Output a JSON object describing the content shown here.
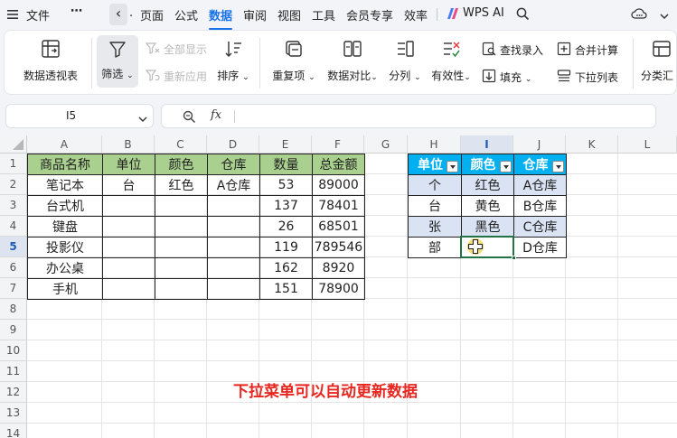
{
  "menu": {
    "file": "文件",
    "more": "⋯",
    "back_chevron": "‹",
    "dot": ".",
    "tabs": [
      "页面",
      "公式",
      "数据",
      "审阅",
      "视图",
      "工具",
      "会员专享",
      "效率"
    ],
    "active_tab": "数据",
    "wps_ai": "WPS AI"
  },
  "ribbon": {
    "pivot": "数据透视表",
    "filter": "筛选",
    "show_all": "全部显示",
    "reapply": "重新应用",
    "sort": "排序",
    "duplicates": "重复项",
    "compare": "数据对比",
    "split": "分列",
    "validity": "有效性",
    "lookup_entry": "查找录入",
    "fill": "填充",
    "merge_calc": "合并计算",
    "dropdown_list": "下拉列表",
    "classify_sum": "分类汇"
  },
  "formula_bar": {
    "name_box": "I5",
    "fx": "fx",
    "value": ""
  },
  "columns": [
    "A",
    "B",
    "C",
    "D",
    "E",
    "F",
    "G",
    "H",
    "I",
    "J",
    "K",
    "L"
  ],
  "selected_column": "I",
  "rows": [
    "1",
    "2",
    "3",
    "4",
    "5",
    "6",
    "7",
    "8",
    "9",
    "10",
    "11",
    "12",
    "13",
    "14"
  ],
  "selected_row": "5",
  "table1": {
    "headers": [
      "商品名称",
      "单位",
      "颜色",
      "仓库",
      "数量",
      "总金额"
    ],
    "rows": [
      [
        "笔记本",
        "台",
        "红色",
        "A仓库",
        "53",
        "89000"
      ],
      [
        "台式机",
        "",
        "",
        "",
        "137",
        "78401"
      ],
      [
        "键盘",
        "",
        "",
        "",
        "26",
        "68501"
      ],
      [
        "投影仪",
        "",
        "",
        "",
        "119",
        "789546"
      ],
      [
        "办公桌",
        "",
        "",
        "",
        "162",
        "8920"
      ],
      [
        "手机",
        "",
        "",
        "",
        "151",
        "78900"
      ]
    ]
  },
  "table2": {
    "headers": [
      "单位",
      "颜色",
      "仓库"
    ],
    "rows": [
      [
        "个",
        "红色",
        "A仓库"
      ],
      [
        "台",
        "黄色",
        "B仓库"
      ],
      [
        "张",
        "黑色",
        "C仓库"
      ],
      [
        "部",
        "",
        "D仓库"
      ]
    ]
  },
  "annotation": "下拉菜单可以自动更新数据",
  "colors": {
    "accent": "#1a73e8",
    "green_header": "#a9d08e",
    "blue_header": "#00b0f0",
    "light_blue": "#dae3f3",
    "annotation_red": "#e8261f",
    "selection_green": "#217346"
  }
}
